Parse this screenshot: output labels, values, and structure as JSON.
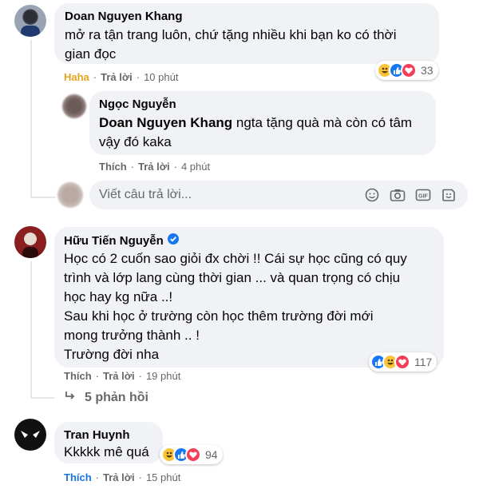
{
  "comments": [
    {
      "author": "Doan Nguyen Khang",
      "text": "mở ra tận trang luôn, chứ tặng nhiều khi bạn ko có thời\ngian đọc",
      "actions": {
        "reaction": "Haha",
        "reply": "Trả lời",
        "time": "10 phút"
      },
      "reaction_count": "33"
    },
    {
      "author": "Ngọc Nguyễn",
      "mention": "Doan Nguyen Khang",
      "text_after_mention": " ngta tặng quà mà còn có tâm\nvậy đó kaka",
      "actions": {
        "like": "Thích",
        "reply": "Trả lời",
        "time": "4 phút"
      }
    },
    {
      "author": "Hữu Tiến Nguyễn",
      "verified": true,
      "text": "Học có 2 cuốn sao giỏi đx chời !! Cái sự học cũng có quy\ntrình và lớp lang cùng thời gian ... và quan trọng có chịu\nhọc hay kg nữa ..!\nSau khi học ở trường còn học thêm trường đời mới\nmong trưởng thành .. !\nTrường đời nha",
      "actions": {
        "like": "Thích",
        "reply": "Trả lời",
        "time": "19 phút"
      },
      "reaction_count": "117",
      "more_replies": "5 phản hồi"
    },
    {
      "author": "Tran Huynh",
      "text": "Kkkkk mê quá",
      "actions": {
        "like": "Thích",
        "reply": "Trả lời",
        "time": "15 phút"
      },
      "reaction_count": "94"
    }
  ],
  "reply_input": {
    "placeholder": "Viết câu trả lời..."
  },
  "colors": {
    "haha": "#e5a21d",
    "like_active": "#1b74e4",
    "bubble": "#f0f2f5",
    "secondary_text": "#65676b"
  }
}
